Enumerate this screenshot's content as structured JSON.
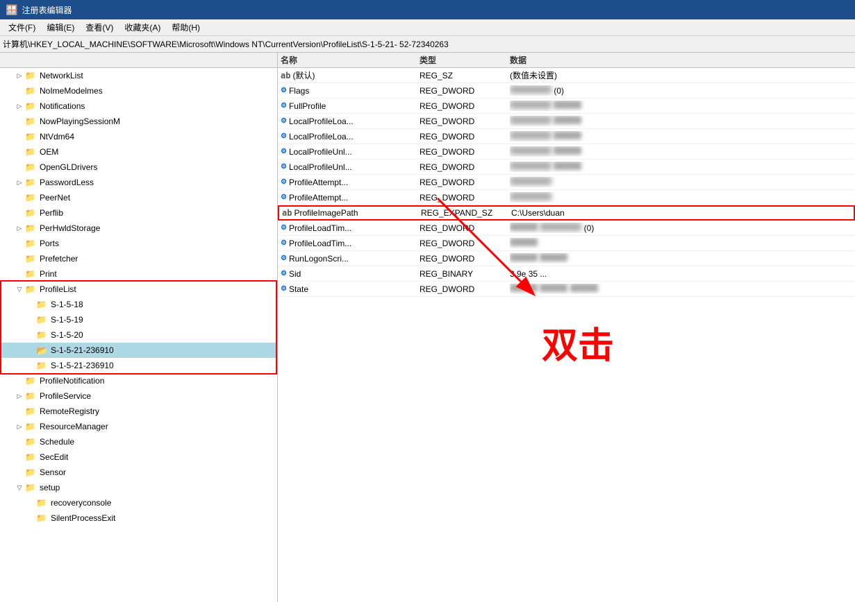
{
  "titleBar": {
    "icon": "🪟",
    "title": "注册表编辑器"
  },
  "menuBar": {
    "items": [
      "文件(F)",
      "编辑(E)",
      "查看(V)",
      "收藏夹(A)",
      "帮助(H)"
    ]
  },
  "addressBar": {
    "label": "计算机\\HKEY_LOCAL_MACHINE\\SOFTWARE\\Microsoft\\Windows NT\\CurrentVersion\\ProfileList\\S-1-5-21-                      52-72340263"
  },
  "columns": {
    "name": "名称",
    "type": "类型",
    "data": "数据"
  },
  "treeItems": [
    {
      "level": 1,
      "label": "NetworkList",
      "hasChildren": true,
      "expanded": false
    },
    {
      "level": 1,
      "label": "NoImeModelmes",
      "hasChildren": false,
      "expanded": false
    },
    {
      "level": 1,
      "label": "Notifications",
      "hasChildren": true,
      "expanded": false
    },
    {
      "level": 1,
      "label": "NowPlayingSessionM",
      "hasChildren": false,
      "expanded": false
    },
    {
      "level": 1,
      "label": "NtVdm64",
      "hasChildren": false,
      "expanded": false
    },
    {
      "level": 1,
      "label": "OEM",
      "hasChildren": false,
      "expanded": false
    },
    {
      "level": 1,
      "label": "OpenGLDrivers",
      "hasChildren": false,
      "expanded": false
    },
    {
      "level": 1,
      "label": "PasswordLess",
      "hasChildren": true,
      "expanded": false
    },
    {
      "level": 1,
      "label": "PeerNet",
      "hasChildren": false,
      "expanded": false
    },
    {
      "level": 1,
      "label": "Perflib",
      "hasChildren": false,
      "expanded": false
    },
    {
      "level": 1,
      "label": "PerHwldStorage",
      "hasChildren": true,
      "expanded": false
    },
    {
      "level": 1,
      "label": "Ports",
      "hasChildren": false,
      "expanded": false
    },
    {
      "level": 1,
      "label": "Prefetcher",
      "hasChildren": false,
      "expanded": false
    },
    {
      "level": 1,
      "label": "Print",
      "hasChildren": false,
      "expanded": false
    },
    {
      "level": 1,
      "label": "ProfileList",
      "hasChildren": true,
      "expanded": true,
      "isProfileList": true
    },
    {
      "level": 2,
      "label": "S-1-5-18",
      "hasChildren": false,
      "expanded": false
    },
    {
      "level": 2,
      "label": "S-1-5-19",
      "hasChildren": false,
      "expanded": false
    },
    {
      "level": 2,
      "label": "S-1-5-20",
      "hasChildren": false,
      "expanded": false
    },
    {
      "level": 2,
      "label": "S-1-5-21-236910",
      "hasChildren": false,
      "expanded": false,
      "selected": true
    },
    {
      "level": 2,
      "label": "S-1-5-21-236910",
      "hasChildren": false,
      "expanded": false
    },
    {
      "level": 1,
      "label": "ProfileNotification",
      "hasChildren": false,
      "expanded": false
    },
    {
      "level": 1,
      "label": "ProfileService",
      "hasChildren": true,
      "expanded": false
    },
    {
      "level": 1,
      "label": "RemoteRegistry",
      "hasChildren": false,
      "expanded": false
    },
    {
      "level": 1,
      "label": "ResourceManager",
      "hasChildren": true,
      "expanded": false
    },
    {
      "level": 1,
      "label": "Schedule",
      "hasChildren": false,
      "expanded": false
    },
    {
      "level": 1,
      "label": "SecEdit",
      "hasChildren": false,
      "expanded": false
    },
    {
      "level": 1,
      "label": "Sensor",
      "hasChildren": false,
      "expanded": false
    },
    {
      "level": 1,
      "label": "setup",
      "hasChildren": true,
      "expanded": true
    },
    {
      "level": 2,
      "label": "recoveryconsole",
      "hasChildren": false,
      "expanded": false
    },
    {
      "level": 2,
      "label": "SilentProcessExit",
      "hasChildren": false,
      "expanded": false
    }
  ],
  "registryValues": [
    {
      "name": "(默认)",
      "type": "REG_SZ",
      "data": "(数值未设置)",
      "icon": "ab",
      "defaultEntry": true
    },
    {
      "name": "Flags",
      "type": "REG_DWORD",
      "data": "blurred1",
      "icon": "dword"
    },
    {
      "name": "FullProfile",
      "type": "REG_DWORD",
      "data": "blurred2",
      "icon": "dword"
    },
    {
      "name": "LocalProfileLoa...",
      "type": "REG_DWORD",
      "data": "blurred3",
      "icon": "dword"
    },
    {
      "name": "LocalProfileLoa...",
      "type": "REG_DWORD",
      "data": "blurred4",
      "icon": "dword"
    },
    {
      "name": "LocalProfileUnl...",
      "type": "REG_DWORD",
      "data": "blurred5",
      "icon": "dword"
    },
    {
      "name": "LocalProfileUnl...",
      "type": "REG_DWORD",
      "data": "blurred6",
      "icon": "dword"
    },
    {
      "name": "ProfileAttempt...",
      "type": "REG_DWORD",
      "data": "blurred7",
      "icon": "dword"
    },
    {
      "name": "ProfileAttempt...",
      "type": "REG_DWORD",
      "data": "blurred8",
      "icon": "dword"
    },
    {
      "name": "ProfileImagePath",
      "type": "REG_EXPAND_SZ",
      "data": "C:\\Users\\duan",
      "icon": "ab",
      "selected": true
    },
    {
      "name": "ProfileLoadTim...",
      "type": "REG_DWORD",
      "data": "blurred9",
      "icon": "dword"
    },
    {
      "name": "ProfileLoadTim...",
      "type": "REG_DWORD",
      "data": "blurred10",
      "icon": "dword"
    },
    {
      "name": "RunLogonScri...",
      "type": "REG_DWORD",
      "data": "blurred11",
      "icon": "dword"
    },
    {
      "name": "Sid",
      "type": "REG_BINARY",
      "data": "3 9e 35 ...",
      "icon": "bin"
    },
    {
      "name": "State",
      "type": "REG_DWORD",
      "data": "blurred12",
      "icon": "dword"
    }
  ],
  "annotation": {
    "doubleClickText": "双击"
  }
}
